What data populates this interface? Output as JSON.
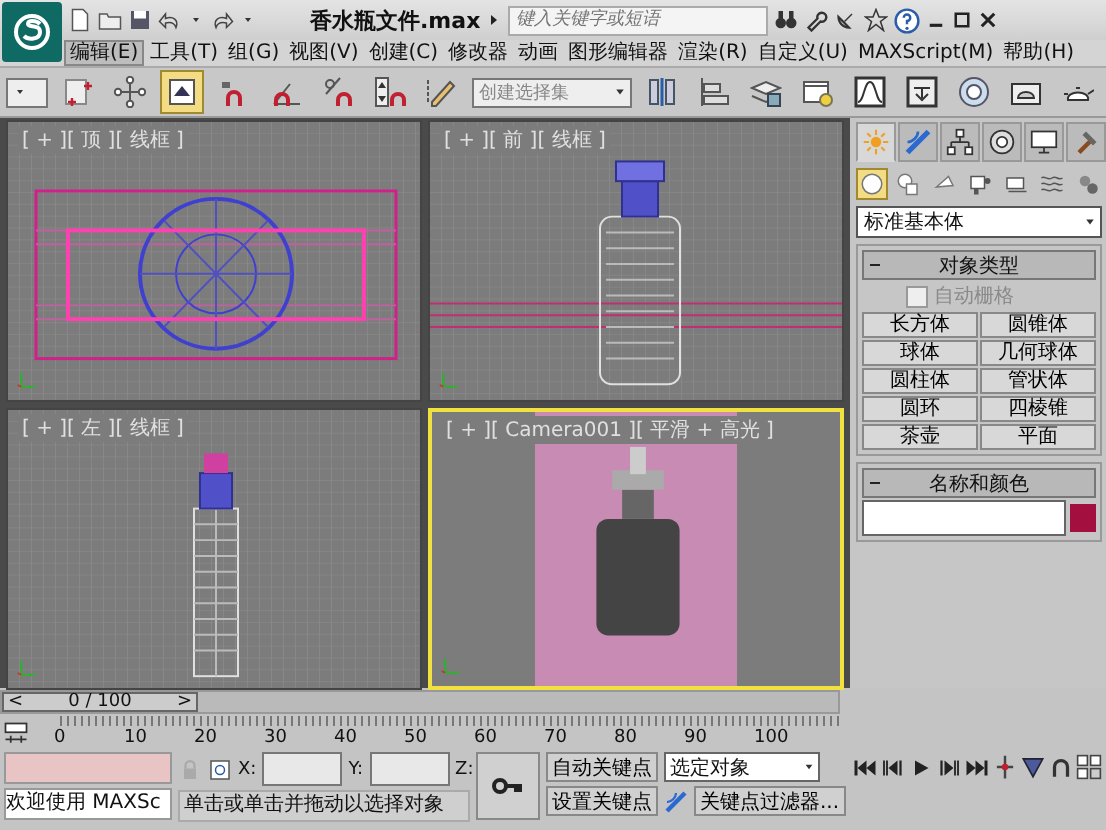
{
  "title_bar": {
    "title": "香水瓶文件.max",
    "search_placeholder": "键入关键字或短语"
  },
  "menu": [
    {
      "label": "编辑(E)",
      "selected": true
    },
    {
      "label": "工具(T)",
      "selected": false
    },
    {
      "label": "组(G)",
      "selected": false
    },
    {
      "label": "视图(V)",
      "selected": false
    },
    {
      "label": "创建(C)",
      "selected": false
    },
    {
      "label": "修改器",
      "selected": false
    },
    {
      "label": "动画",
      "selected": false
    },
    {
      "label": "图形编辑器",
      "selected": false
    },
    {
      "label": "渲染(R)",
      "selected": false
    },
    {
      "label": "自定义(U)",
      "selected": false
    },
    {
      "label": "MAXScript(M)",
      "selected": false
    },
    {
      "label": "帮助(H)",
      "selected": false
    }
  ],
  "toolbar": {
    "select_object_selected": true,
    "selection_set_placeholder": "创建选择集"
  },
  "viewports": [
    {
      "label": "[ + ][ 顶 ][ 线框 ]",
      "kind": "top",
      "active": false
    },
    {
      "label": "[ + ][ 前 ][ 线框 ]",
      "kind": "front",
      "active": false
    },
    {
      "label": "[ + ][ 左 ][ 线框 ]",
      "kind": "left",
      "active": false
    },
    {
      "label": "[ + ][ Camera001 ][ 平滑 + 高光 ]",
      "kind": "camera",
      "active": true
    }
  ],
  "command_panel": {
    "tabs": [
      {
        "selected": true
      },
      {
        "selected": false
      },
      {
        "selected": false
      },
      {
        "selected": false
      },
      {
        "selected": false
      },
      {
        "selected": false
      }
    ],
    "categories": [
      {
        "selected": true
      },
      {
        "selected": false
      },
      {
        "selected": false
      },
      {
        "selected": false
      },
      {
        "selected": false
      },
      {
        "selected": false
      },
      {
        "selected": false
      }
    ],
    "category": "标准基本体",
    "object_type": {
      "title": "对象类型",
      "auto_grid": {
        "label": "自动栅格",
        "checked": false,
        "disabled": true
      },
      "buttons": [
        "长方体",
        "圆锥体",
        "球体",
        "几何球体",
        "圆柱体",
        "管状体",
        "圆环",
        "四棱锥",
        "茶壶",
        "平面"
      ]
    },
    "name_and_color": {
      "title": "名称和颜色",
      "color": "#a3103f"
    }
  },
  "time_slider": {
    "prev": "<",
    "position": "0 / 100",
    "next": ">",
    "level": 0,
    "ticks": [
      "0",
      "10",
      "20",
      "30",
      "40",
      "50",
      "60",
      "70",
      "80",
      "90",
      "100"
    ]
  },
  "status": {
    "script_line": "欢迎使用 MAXSc",
    "coord_labels": [
      "X:",
      "Y:",
      "Z:"
    ],
    "prompt": "单击或单击并拖动以选择对象",
    "auto_key": "自动关键点",
    "set_key": "设置关键点",
    "key_mode": "选定对象",
    "key_filters": "关键点过滤器..."
  }
}
